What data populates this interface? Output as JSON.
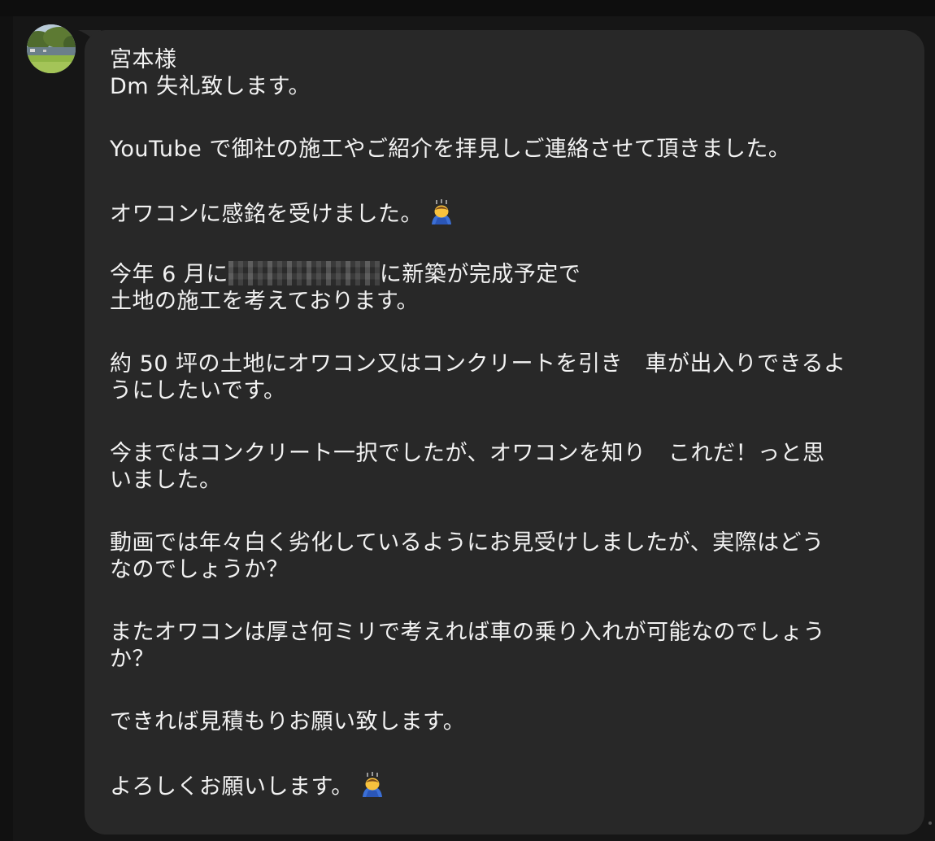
{
  "sender": {
    "avatar_icon": "park-photo-avatar"
  },
  "message": {
    "greeting": "宮本様",
    "line_dm": "Dm 失礼致します。",
    "line_youtube": "YouTube で御社の施工やご紹介を拝見しご連絡させて頂きました。",
    "line_impressed": "オワコンに感銘を受けました。",
    "line_june_before": "今年 6 月に",
    "line_june_after": "に新築が完成予定で",
    "line_land": "土地の施工を考えております。",
    "line_50_1": "約 50 坪の土地にオワコン又はコンクリートを引き　車が出入りできるよ",
    "line_50_2": "うにしたいです。",
    "line_until_1": "今まではコンクリート一択でしたが、オワコンを知り　これだ！っと思",
    "line_until_2": "いました。",
    "line_video_1": "動画では年々白く劣化しているようにお見受けしましたが、実際はどう",
    "line_video_2": "なのでしょうか？",
    "line_thick_1": "またオワコンは厚さ何ミリで考えれば車の乗り入れが可能なのでしょう",
    "line_thick_2": "か？",
    "line_estimate": "できれば見積もりお願い致します。",
    "line_regards": "よろしくお願いします。",
    "emoji_icon": "bowing-person-emoji"
  },
  "colors": {
    "bubble": "#282828",
    "text": "#f2f2f2",
    "background": "#161616"
  }
}
